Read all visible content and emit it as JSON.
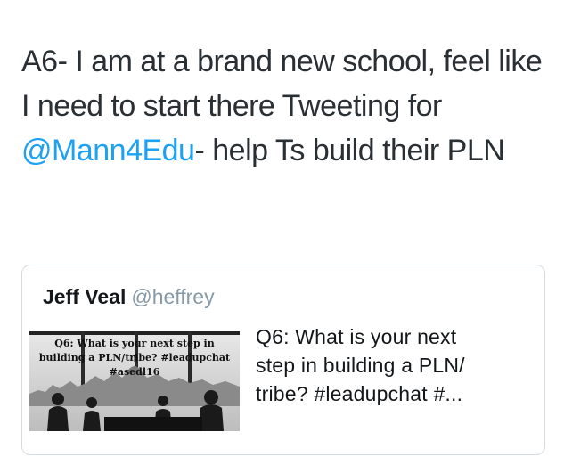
{
  "tweet": {
    "text_before": "A6- I am at a brand new school, feel like I need to start there Tweeting for ",
    "mention": "@Mann4Edu",
    "text_after": "- help Ts build their PLN"
  },
  "quoted_tweet": {
    "author_name": "Jeff Veal",
    "author_handle": "@heffrey",
    "image_caption": [
      "Q6: What is your next step in",
      "building a PLN/tribe? #leadupchat",
      "#asedl16"
    ],
    "text_lines": [
      "Q6: What is your next",
      "step in building a PLN/",
      "tribe? #leadupchat  #..."
    ]
  },
  "colors": {
    "mention": "#1da1f2",
    "text": "#292f33",
    "handle": "#8899a6",
    "border": "#d6dbe0"
  }
}
